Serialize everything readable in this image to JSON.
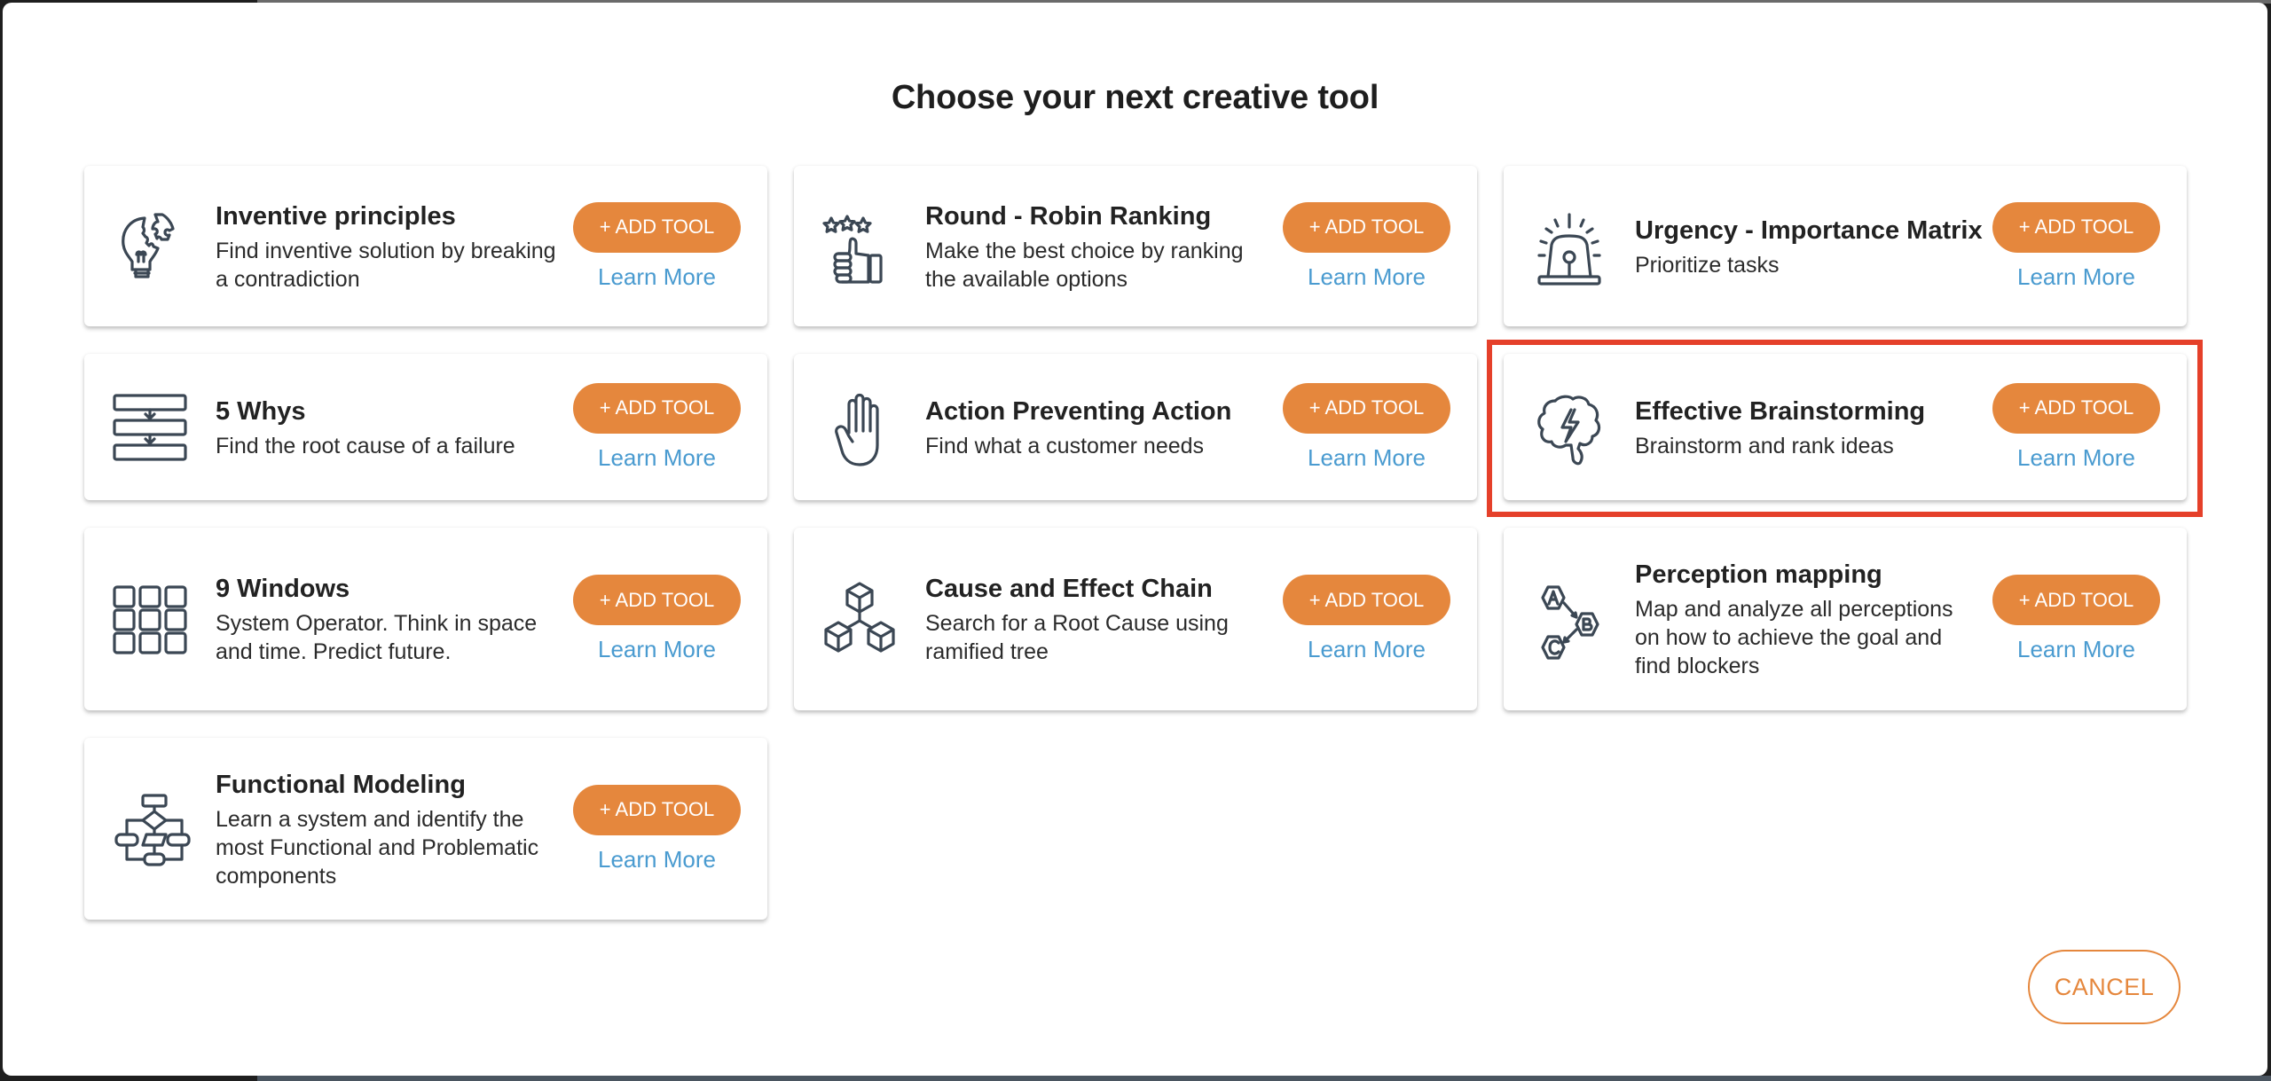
{
  "dialog": {
    "title": "Choose your next creative tool",
    "cancel_label": "CANCEL"
  },
  "colors": {
    "accent": "#e5873d",
    "link": "#4a9bd0",
    "highlight": "#e5402a",
    "icon": "#3b4754"
  },
  "tools": [
    {
      "title": "Inventive principles",
      "description": "Find inventive solution by breaking a contradiction",
      "icon": "lightbulb-puzzle-icon",
      "add_label": "+ ADD TOOL",
      "learn_label": "Learn More"
    },
    {
      "title": "Round - Robin Ranking",
      "description": "Make the best choice by ranking the available options",
      "icon": "thumbs-up-stars-icon",
      "add_label": "+ ADD TOOL",
      "learn_label": "Learn More"
    },
    {
      "title": "Urgency - Importance Matrix",
      "description": "Prioritize tasks",
      "icon": "siren-icon",
      "add_label": "+ ADD TOOL",
      "learn_label": "Learn More"
    },
    {
      "title": "5 Whys",
      "description": "Find the root cause of a failure",
      "icon": "flow-steps-icon",
      "add_label": "+ ADD TOOL",
      "learn_label": "Learn More"
    },
    {
      "title": "Action Preventing Action",
      "description": "Find what a customer needs",
      "icon": "hand-stop-icon",
      "add_label": "+ ADD TOOL",
      "learn_label": "Learn More"
    },
    {
      "title": "Effective Brainstorming",
      "description": "Brainstorm and rank ideas",
      "icon": "brain-lightning-icon",
      "add_label": "+ ADD TOOL",
      "learn_label": "Learn More",
      "highlighted": true
    },
    {
      "title": "9 Windows",
      "description": "System Operator. Think in space and time. Predict future.",
      "icon": "nine-windows-grid-icon",
      "add_label": "+ ADD TOOL",
      "learn_label": "Learn More"
    },
    {
      "title": "Cause and Effect Chain",
      "description": "Search for a Root Cause using ramified tree",
      "icon": "cubes-tree-icon",
      "add_label": "+ ADD TOOL",
      "learn_label": "Learn More"
    },
    {
      "title": "Perception mapping",
      "description": "Map and analyze all perceptions on how to achieve the goal and find blockers",
      "icon": "abc-hexagons-icon",
      "add_label": "+ ADD TOOL",
      "learn_label": "Learn More"
    },
    {
      "title": "Functional Modeling",
      "description": "Learn a system and identify the most Functional and Problematic components",
      "icon": "flowchart-icon",
      "add_label": "+ ADD TOOL",
      "learn_label": "Learn More"
    }
  ]
}
